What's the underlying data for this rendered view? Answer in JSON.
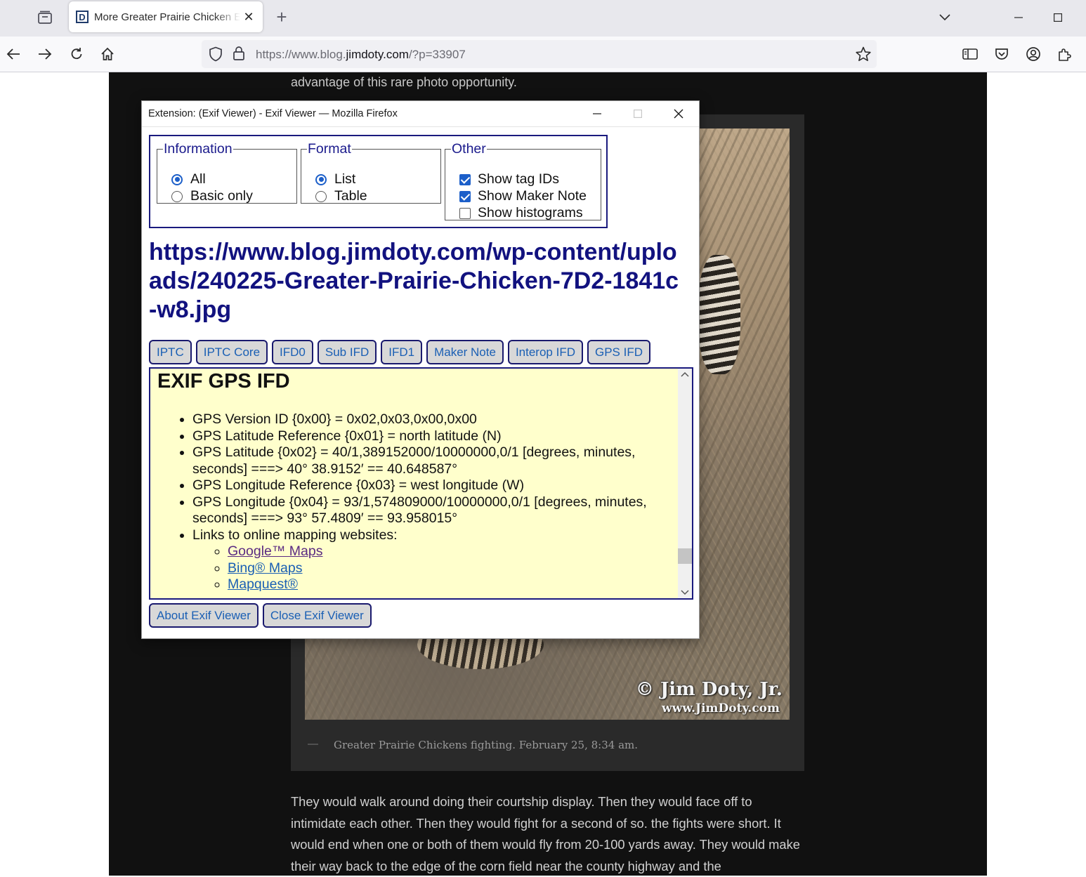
{
  "browser": {
    "tab_title": "More Greater Prairie Chicken Ex",
    "favicon_letter": "D",
    "url_prefix": "https://www.blog.",
    "url_domain": "jimdoty.com",
    "url_suffix": "/?p=33907"
  },
  "page": {
    "top_text": "advantage of this rare photo opportunity.",
    "watermark_line1": "© Jim Doty, Jr.",
    "watermark_line2": "www.JimDoty.com",
    "caption": "Greater Prairie Chickens fighting. February 25, 8:34 am.",
    "body_text": "They would walk around doing their courtship display. Then they would face off to intimidate each other. Then they would fight for a second of so. the fights were short. It would end when one or both of them would fly from 20-100 yards away. They would make their way back to the edge of the corn field near the county highway and the"
  },
  "popup": {
    "title": "Extension: (Exif Viewer) - Exif Viewer — Mozilla Firefox",
    "information": {
      "legend": "Information",
      "options": [
        "All",
        "Basic only"
      ],
      "selected": "All"
    },
    "format": {
      "legend": "Format",
      "options": [
        "List",
        "Table"
      ],
      "selected": "List"
    },
    "other": {
      "legend": "Other",
      "show_tag_ids": "Show tag IDs",
      "show_maker_note": "Show Maker Note",
      "show_histograms": "Show histograms",
      "show_tag_ids_checked": true,
      "show_maker_note_checked": true,
      "show_histograms_checked": false
    },
    "image_url": "https://www.blog.jimdoty.com/wp-content/uploads/240225-Greater-Prairie-Chicken-7D2-1841c-w8.jpg",
    "tabs": [
      "IPTC",
      "IPTC Core",
      "IFD0",
      "Sub IFD",
      "IFD1",
      "Maker Note",
      "Interop IFD",
      "GPS IFD"
    ],
    "section_title": "EXIF GPS IFD",
    "gps": [
      "GPS Version ID {0x00} = 0x02,0x03,0x00,0x00",
      "GPS Latitude Reference {0x01} = north latitude (N)",
      "GPS Latitude {0x02} = 40/1,389152000/10000000,0/1 [degrees, minutes, seconds] ===> 40° 38.9152′ == 40.648587°",
      "GPS Longitude Reference {0x03} = west longitude (W)",
      "GPS Longitude {0x04} = 93/1,574809000/10000000,0/1 [degrees, minutes, seconds] ===> 93° 57.4809′ == 93.958015°",
      "Links to online mapping websites:"
    ],
    "map_links": [
      "Google™ Maps",
      "Bing® Maps",
      "Mapquest®"
    ],
    "about_button": "About Exif Viewer",
    "close_button": "Close Exif Viewer"
  }
}
